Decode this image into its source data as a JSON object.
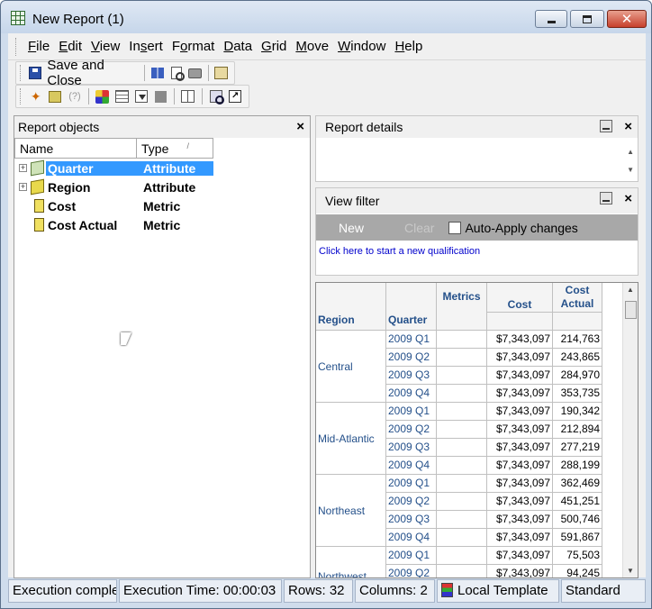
{
  "window": {
    "title": "New Report (1)"
  },
  "menu": [
    "File",
    "Edit",
    "View",
    "Insert",
    "Format",
    "Data",
    "Grid",
    "Move",
    "Window",
    "Help"
  ],
  "menu_accel": [
    "F",
    "E",
    "V",
    "s",
    "o",
    "D",
    "G",
    "M",
    "W",
    "H"
  ],
  "toolbar": {
    "save_close": "Save and Close"
  },
  "objects_pane": {
    "title": "Report objects",
    "col_name": "Name",
    "col_type": "Type",
    "items": [
      {
        "name": "Quarter",
        "type": "Attribute",
        "icon": "attribute-icon"
      },
      {
        "name": "Region",
        "type": "Attribute",
        "icon": "attribute-icon"
      },
      {
        "name": "Cost",
        "type": "Metric",
        "icon": "metric-icon"
      },
      {
        "name": "Cost Actual",
        "type": "Metric",
        "icon": "metric-icon"
      }
    ]
  },
  "details_pane": {
    "title": "Report details"
  },
  "filter_pane": {
    "title": "View filter",
    "new_label": "New",
    "clear_label": "Clear",
    "auto_apply_label": "Auto-Apply changes",
    "link_text": "Click here to start a new qualification"
  },
  "grid": {
    "headers": {
      "region": "Region",
      "quarter": "Quarter",
      "metrics": "Metrics",
      "cost": "Cost",
      "cost_actual": "Cost Actual"
    },
    "rows": [
      {
        "region": "Central",
        "quarters": [
          {
            "q": "2009 Q1",
            "cost": "$7,343,097",
            "actual": "214,763"
          },
          {
            "q": "2009 Q2",
            "cost": "$7,343,097",
            "actual": "243,865"
          },
          {
            "q": "2009 Q3",
            "cost": "$7,343,097",
            "actual": "284,970"
          },
          {
            "q": "2009 Q4",
            "cost": "$7,343,097",
            "actual": "353,735"
          }
        ]
      },
      {
        "region": "Mid-Atlantic",
        "quarters": [
          {
            "q": "2009 Q1",
            "cost": "$7,343,097",
            "actual": "190,342"
          },
          {
            "q": "2009 Q2",
            "cost": "$7,343,097",
            "actual": "212,894"
          },
          {
            "q": "2009 Q3",
            "cost": "$7,343,097",
            "actual": "277,219"
          },
          {
            "q": "2009 Q4",
            "cost": "$7,343,097",
            "actual": "288,199"
          }
        ]
      },
      {
        "region": "Northeast",
        "quarters": [
          {
            "q": "2009 Q1",
            "cost": "$7,343,097",
            "actual": "362,469"
          },
          {
            "q": "2009 Q2",
            "cost": "$7,343,097",
            "actual": "451,251"
          },
          {
            "q": "2009 Q3",
            "cost": "$7,343,097",
            "actual": "500,746"
          },
          {
            "q": "2009 Q4",
            "cost": "$7,343,097",
            "actual": "591,867"
          }
        ]
      },
      {
        "region": "Northwest",
        "quarters": [
          {
            "q": "2009 Q1",
            "cost": "$7,343,097",
            "actual": "75,503"
          },
          {
            "q": "2009 Q2",
            "cost": "$7,343,097",
            "actual": "94,245"
          }
        ]
      }
    ]
  },
  "status": {
    "execution": "Execution complete",
    "time": "Execution Time: 00:00:03",
    "rows": "Rows: 32",
    "columns": "Columns: 2",
    "template": "Local Template",
    "mode": "Standard"
  }
}
